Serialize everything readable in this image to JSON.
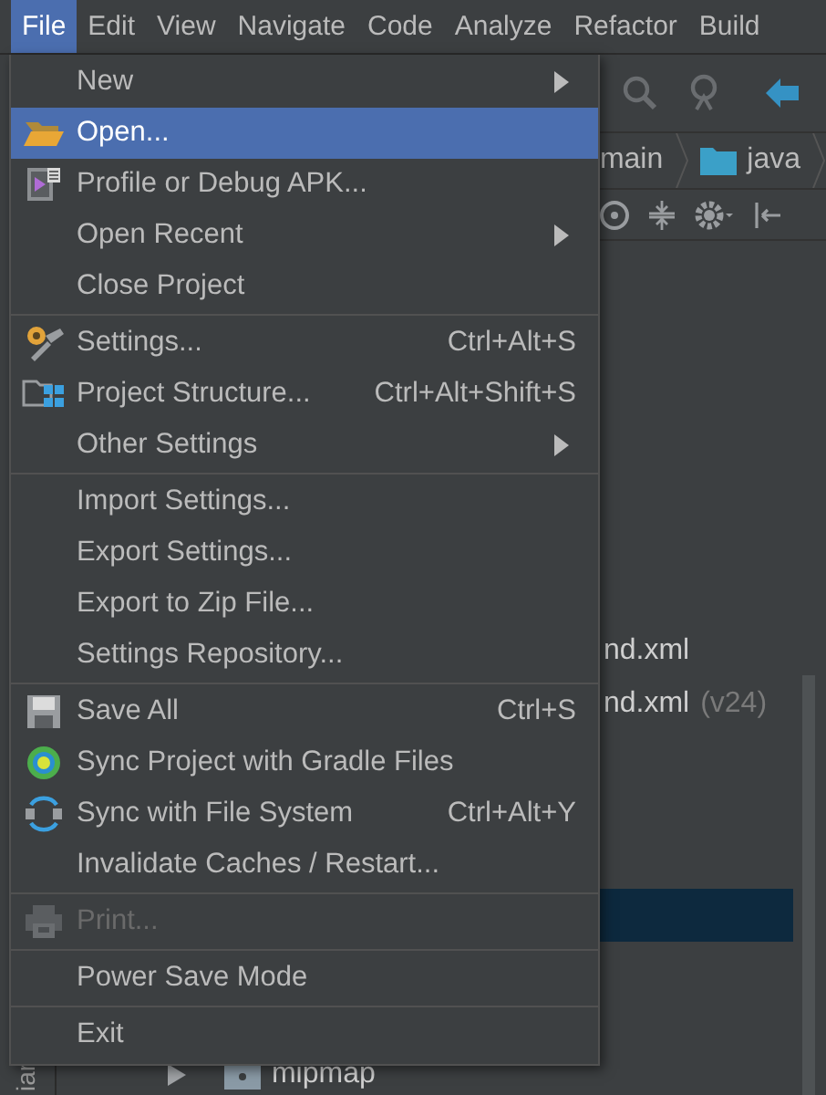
{
  "menubar": [
    {
      "label": "File",
      "selected": true
    },
    {
      "label": "Edit",
      "selected": false
    },
    {
      "label": "View",
      "selected": false
    },
    {
      "label": "Navigate",
      "selected": false
    },
    {
      "label": "Code",
      "selected": false
    },
    {
      "label": "Analyze",
      "selected": false
    },
    {
      "label": "Refactor",
      "selected": false
    },
    {
      "label": "Build",
      "selected": false
    }
  ],
  "breadcrumb": [
    {
      "label": "main",
      "kind": "text"
    },
    {
      "label": "java",
      "kind": "folder"
    }
  ],
  "side_strip": {
    "label": "iar"
  },
  "tree": [
    {
      "label": "nd.xml",
      "selected": false
    },
    {
      "label": "nd.xml",
      "note": "(v24)",
      "selected": false
    },
    {
      "selected": true
    },
    {
      "label": "mipmap",
      "expanded": false,
      "selected": false
    }
  ],
  "file_menu": [
    {
      "kind": "item",
      "label": "New",
      "submenu": true,
      "selected": false,
      "disabled": false
    },
    {
      "kind": "item",
      "label": "Open...",
      "submenu": false,
      "selected": true,
      "disabled": false
    },
    {
      "kind": "item",
      "label": "Profile or Debug APK...",
      "submenu": false,
      "selected": false,
      "disabled": false
    },
    {
      "kind": "item",
      "label": "Open Recent",
      "submenu": true,
      "selected": false,
      "disabled": false
    },
    {
      "kind": "item",
      "label": "Close Project",
      "submenu": false,
      "selected": false,
      "disabled": false
    },
    {
      "kind": "separator"
    },
    {
      "kind": "item",
      "label": "Settings...",
      "shortcut": "Ctrl+Alt+S",
      "submenu": false,
      "selected": false,
      "disabled": false
    },
    {
      "kind": "item",
      "label": "Project Structure...",
      "shortcut": "Ctrl+Alt+Shift+S",
      "submenu": false,
      "selected": false,
      "disabled": false
    },
    {
      "kind": "item",
      "label": "Other Settings",
      "submenu": true,
      "selected": false,
      "disabled": false
    },
    {
      "kind": "separator"
    },
    {
      "kind": "item",
      "label": "Import Settings...",
      "submenu": false,
      "selected": false,
      "disabled": false
    },
    {
      "kind": "item",
      "label": "Export Settings...",
      "submenu": false,
      "selected": false,
      "disabled": false
    },
    {
      "kind": "item",
      "label": "Export to Zip File...",
      "submenu": false,
      "selected": false,
      "disabled": false
    },
    {
      "kind": "item",
      "label": "Settings Repository...",
      "submenu": false,
      "selected": false,
      "disabled": false
    },
    {
      "kind": "separator"
    },
    {
      "kind": "item",
      "label": "Save All",
      "shortcut": "Ctrl+S",
      "submenu": false,
      "selected": false,
      "disabled": false
    },
    {
      "kind": "item",
      "label": "Sync Project with Gradle Files",
      "submenu": false,
      "selected": false,
      "disabled": false
    },
    {
      "kind": "item",
      "label": "Sync with File System",
      "shortcut": "Ctrl+Alt+Y",
      "submenu": false,
      "selected": false,
      "disabled": false
    },
    {
      "kind": "item",
      "label": "Invalidate Caches / Restart...",
      "submenu": false,
      "selected": false,
      "disabled": false
    },
    {
      "kind": "separator"
    },
    {
      "kind": "item",
      "label": "Print...",
      "submenu": false,
      "selected": false,
      "disabled": true
    },
    {
      "kind": "separator"
    },
    {
      "kind": "item",
      "label": "Power Save Mode",
      "submenu": false,
      "selected": false,
      "disabled": false
    },
    {
      "kind": "separator"
    },
    {
      "kind": "item",
      "label": "Exit",
      "submenu": false,
      "selected": false,
      "disabled": false
    }
  ]
}
